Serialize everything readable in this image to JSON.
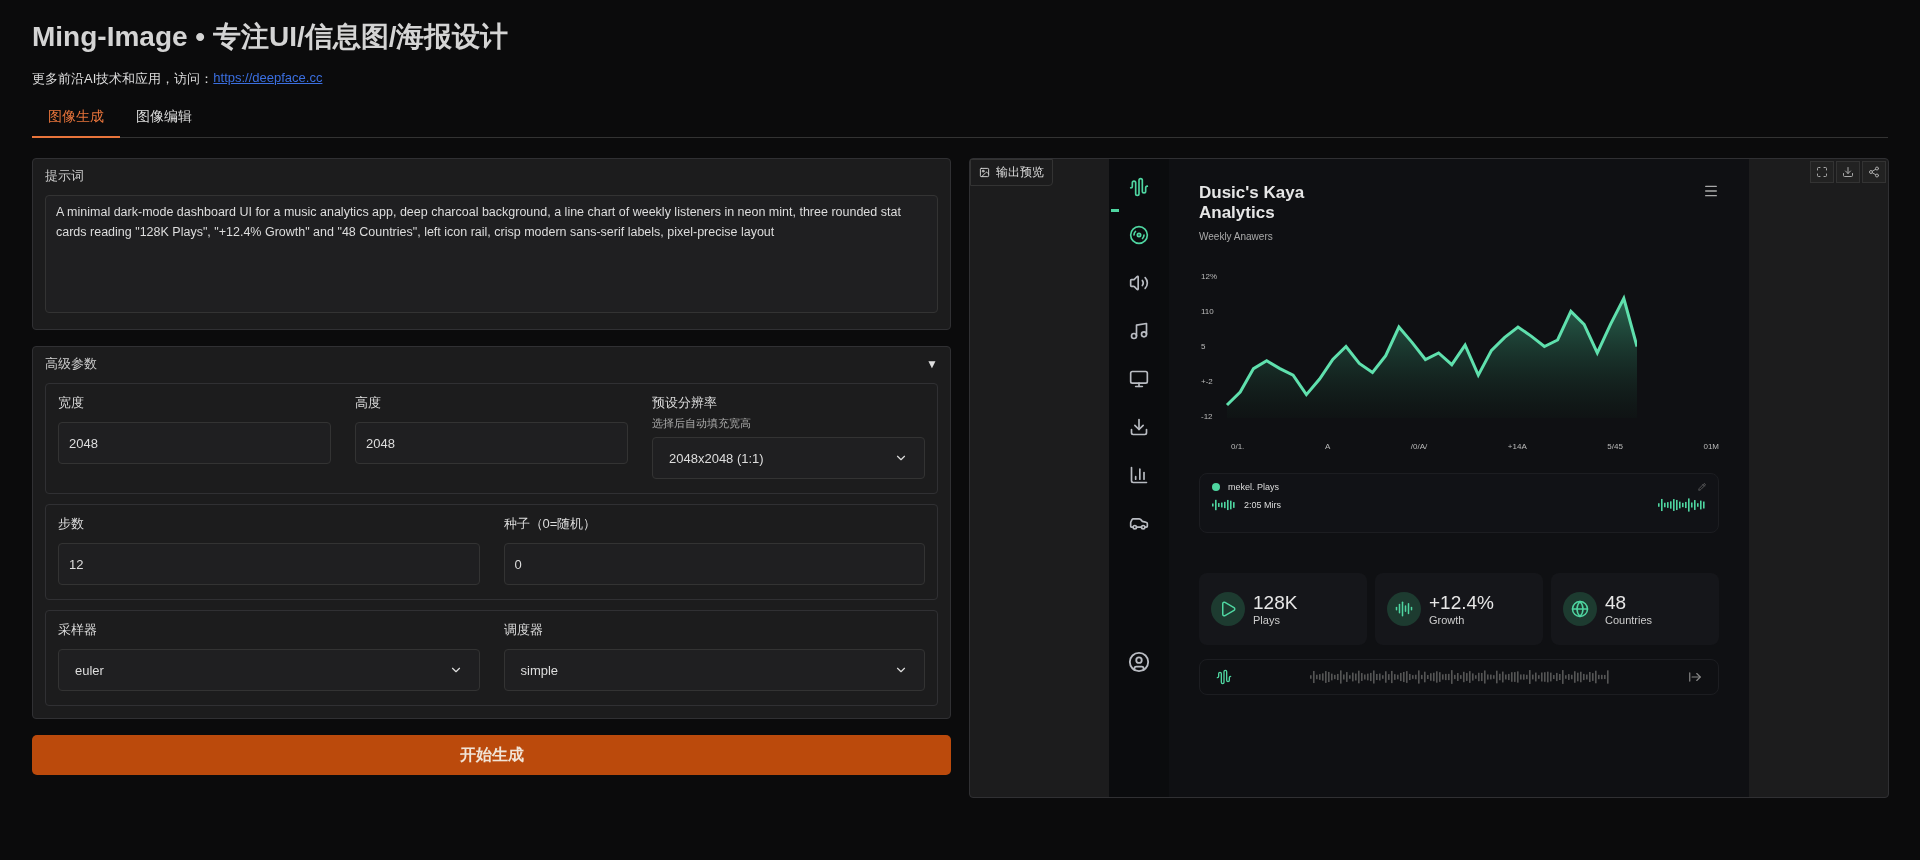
{
  "header": {
    "title": "Ming-Image • 专注UI/信息图/海报设计",
    "subtitle": "更多前沿AI技术和应用，访问：",
    "link": "https://deepface.cc"
  },
  "tabs": [
    {
      "label": "图像生成",
      "selected": true
    },
    {
      "label": "图像编辑",
      "selected": false
    }
  ],
  "prompt": {
    "label": "提示词",
    "value": "A minimal dark-mode dashboard UI for a music analytics app, deep charcoal background, a line chart of weekly listeners in neon mint, three rounded stat cards reading \"128K Plays\", \"+12.4% Growth\" and \"48 Countries\", left icon rail, crisp modern sans-serif labels, pixel-precise layout"
  },
  "advanced": {
    "title": "高级参数",
    "toggle": "▼",
    "groups": [
      {
        "fields": [
          {
            "kind": "input",
            "label": "宽度",
            "value": "2048"
          },
          {
            "kind": "input",
            "label": "高度",
            "value": "2048"
          },
          {
            "kind": "select",
            "label": "预设分辨率",
            "hint": "选择后自动填充宽高",
            "value": "2048x2048 (1:1)"
          }
        ]
      },
      {
        "fields": [
          {
            "kind": "input",
            "label": "步数",
            "value": "12"
          },
          {
            "kind": "input",
            "label": "种子（0=随机）",
            "value": "0"
          }
        ]
      },
      {
        "fields": [
          {
            "kind": "select",
            "label": "采样器",
            "value": "euler"
          },
          {
            "kind": "select",
            "label": "调度器",
            "value": "simple"
          }
        ]
      }
    ]
  },
  "generate_button": "开始生成",
  "output": {
    "label": "输出预览",
    "image": {
      "title_lines": [
        "Dusic's Kaya",
        "Analytics"
      ],
      "subtitle": "Weekly Anawers",
      "y_ticks": [
        "12%",
        "110",
        "5",
        "+-2",
        "-12"
      ],
      "x_ticks": [
        "0/1.",
        "A",
        "/0/A/",
        "+14A",
        "5/45",
        "01M"
      ],
      "player": {
        "title": "mekel. Plays",
        "time": "2:05 Mirs"
      },
      "stats": [
        {
          "value": "128K",
          "label": "Plays"
        },
        {
          "value": "+12.4%",
          "label": "Growth"
        },
        {
          "value": "48",
          "label": "Countries"
        }
      ]
    }
  }
}
